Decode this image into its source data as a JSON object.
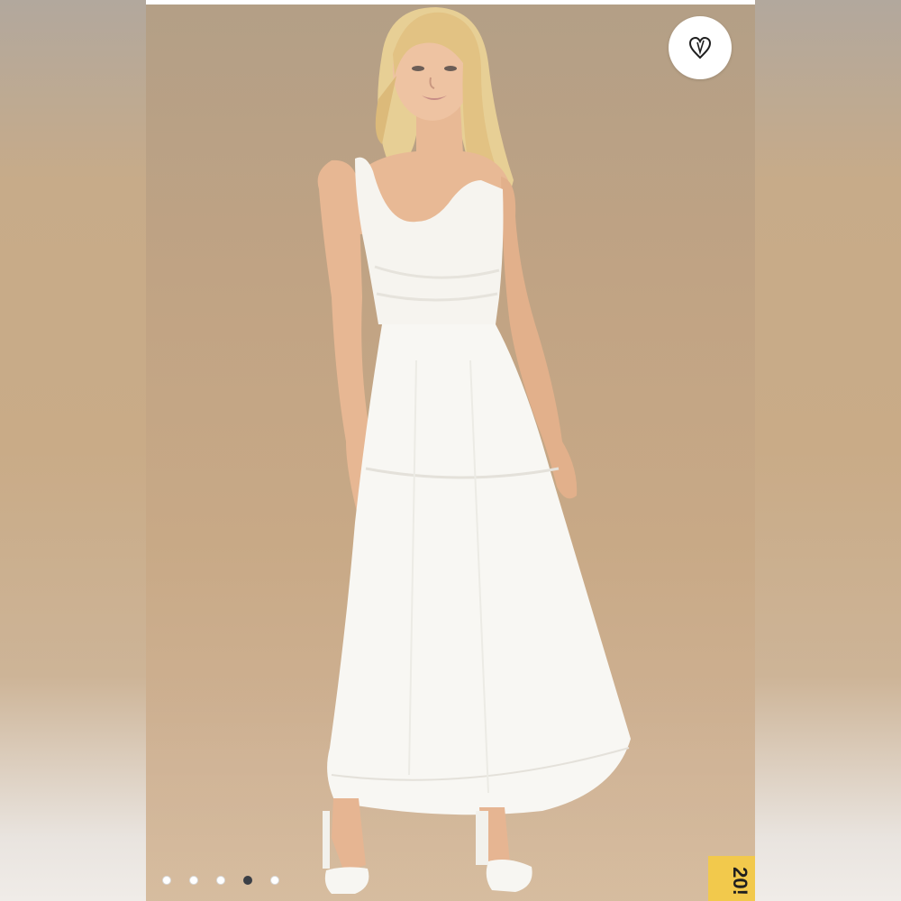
{
  "listing": {
    "image_count": 5,
    "active_image_index": 3,
    "promo_tag_text": "20!"
  },
  "icons": {
    "like": "heart-icon"
  },
  "colors": {
    "dot_active": "#3b3f46",
    "dot_inactive": "#ffffff",
    "promo_tab": "#f2c94c",
    "photo_backdrop": "#c8a986"
  }
}
